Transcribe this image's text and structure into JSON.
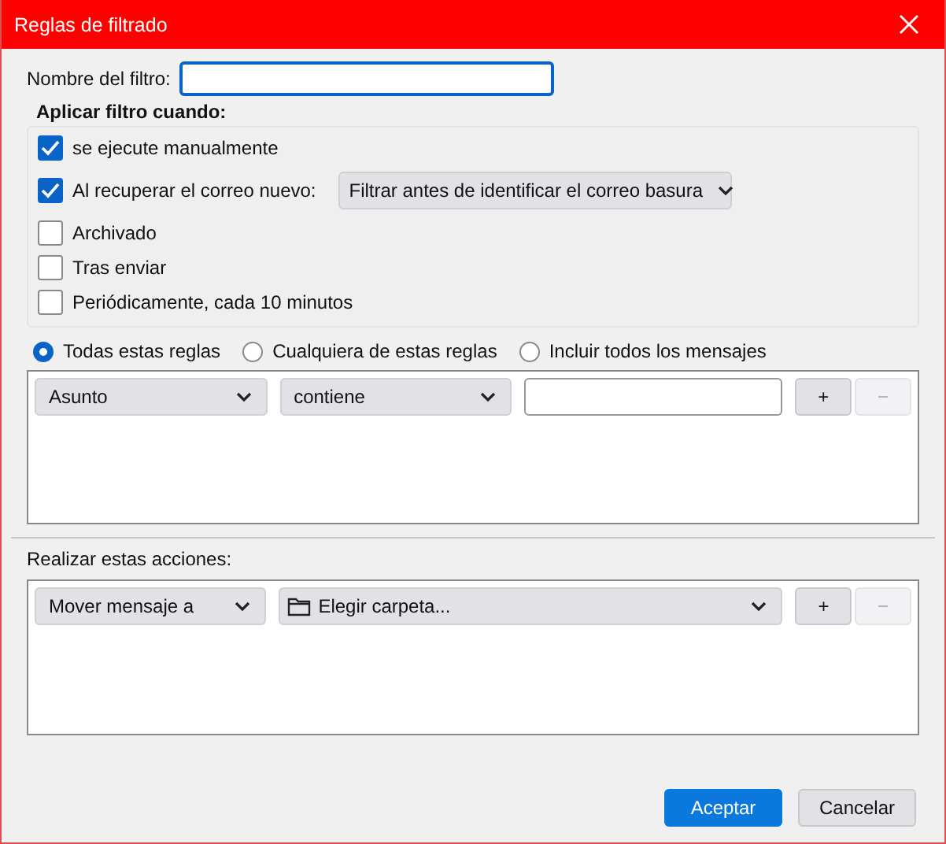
{
  "window": {
    "title": "Reglas de filtrado"
  },
  "name_field": {
    "label": "Nombre del filtro:",
    "focused": true
  },
  "apply_group": {
    "title": "Aplicar filtro cuando:",
    "options": [
      {
        "kind": "checkbox",
        "label": "se ejecute manualmente",
        "checked": true
      },
      {
        "kind": "checkbox-select",
        "label": "Al recuperar el correo nuevo:",
        "checked": true,
        "select": "Filtrar antes de identificar el correo basura"
      },
      {
        "kind": "checkbox",
        "label": "Archivado",
        "checked": false
      },
      {
        "kind": "checkbox",
        "label": "Tras enviar",
        "checked": false
      },
      {
        "kind": "checkbox",
        "label": "Periódicamente, cada 10 minutos",
        "checked": false
      }
    ]
  },
  "match_mode": [
    {
      "label": "Todas estas reglas",
      "selected": true
    },
    {
      "label": "Cualquiera de estas reglas",
      "selected": false
    },
    {
      "label": "Incluir todos los mensajes",
      "selected": false
    }
  ],
  "rules": [
    {
      "field": "Asunto",
      "operator": "contiene",
      "add": "+",
      "remove": "−",
      "remove_disabled": true
    }
  ],
  "actions_label": "Realizar estas acciones:",
  "actions": [
    {
      "action": "Mover mensaje a",
      "target": "Elegir carpeta...",
      "add": "+",
      "remove": "−",
      "remove_disabled": true
    }
  ],
  "buttons": [
    {
      "kind": "primary",
      "label": "Aceptar"
    },
    {
      "kind": "normal",
      "label": "Cancelar"
    }
  ]
}
